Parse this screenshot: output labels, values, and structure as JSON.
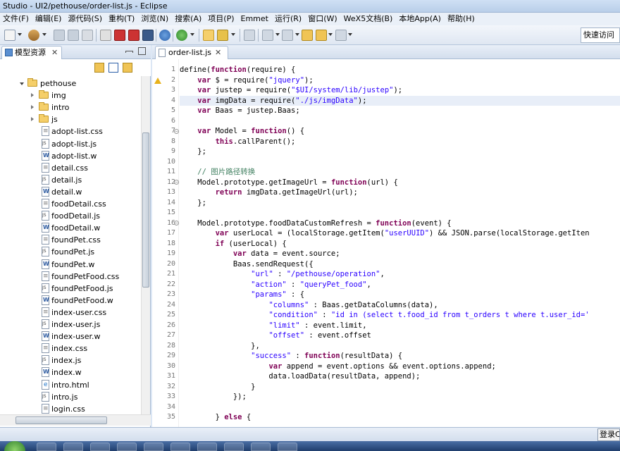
{
  "window": {
    "title": "Studio - UI2/pethouse/order-list.js - Eclipse"
  },
  "menu": [
    "文件(F)",
    "编辑(E)",
    "源代码(S)",
    "重构(T)",
    "浏览(N)",
    "搜索(A)",
    "项目(P)",
    "Emmet",
    "运行(R)",
    "窗口(W)",
    "WeX5文档(B)",
    "本地App(A)",
    "帮助(H)"
  ],
  "toolbar": {
    "quick_access": "快速访问"
  },
  "left_panel": {
    "tab_label": "模型资源",
    "close_glyph": "✕"
  },
  "tree": [
    {
      "label": "pethouse",
      "type": "folder",
      "level": 0,
      "state": "open"
    },
    {
      "label": "img",
      "type": "folder",
      "level": 1,
      "state": "closed"
    },
    {
      "label": "intro",
      "type": "folder",
      "level": 1,
      "state": "closed"
    },
    {
      "label": "js",
      "type": "folder",
      "level": 1,
      "state": "closed"
    },
    {
      "label": "adopt-list.css",
      "type": "css",
      "level": 1
    },
    {
      "label": "adopt-list.js",
      "type": "js",
      "level": 1
    },
    {
      "label": "adopt-list.w",
      "type": "w",
      "level": 1
    },
    {
      "label": "detail.css",
      "type": "css",
      "level": 1
    },
    {
      "label": "detail.js",
      "type": "js",
      "level": 1
    },
    {
      "label": "detail.w",
      "type": "w",
      "level": 1
    },
    {
      "label": "foodDetail.css",
      "type": "css",
      "level": 1
    },
    {
      "label": "foodDetail.js",
      "type": "js",
      "level": 1
    },
    {
      "label": "foodDetail.w",
      "type": "w",
      "level": 1
    },
    {
      "label": "foundPet.css",
      "type": "css",
      "level": 1
    },
    {
      "label": "foundPet.js",
      "type": "js",
      "level": 1
    },
    {
      "label": "foundPet.w",
      "type": "w",
      "level": 1
    },
    {
      "label": "foundPetFood.css",
      "type": "css",
      "level": 1
    },
    {
      "label": "foundPetFood.js",
      "type": "js",
      "level": 1
    },
    {
      "label": "foundPetFood.w",
      "type": "w",
      "level": 1
    },
    {
      "label": "index-user.css",
      "type": "css",
      "level": 1
    },
    {
      "label": "index-user.js",
      "type": "js",
      "level": 1
    },
    {
      "label": "index-user.w",
      "type": "w",
      "level": 1
    },
    {
      "label": "index.css",
      "type": "css",
      "level": 1
    },
    {
      "label": "index.js",
      "type": "js",
      "level": 1
    },
    {
      "label": "index.w",
      "type": "w",
      "level": 1
    },
    {
      "label": "intro.html",
      "type": "html",
      "level": 1
    },
    {
      "label": "intro.js",
      "type": "js",
      "level": 1
    },
    {
      "label": "login.css",
      "type": "css",
      "level": 1
    }
  ],
  "editor": {
    "tab_label": "order-list.js",
    "close_glyph": "✕",
    "warning_line": 2,
    "highlighted_line": 4,
    "fold_lines": [
      7,
      12,
      16
    ],
    "lines": [
      [
        [
          "define(",
          ""
        ],
        [
          "function",
          "kw"
        ],
        [
          "(require) {",
          ""
        ]
      ],
      [
        [
          "    ",
          ""
        ],
        [
          "var",
          "kw"
        ],
        [
          " $ = require(",
          ""
        ],
        [
          "\"jquery\"",
          "str"
        ],
        [
          ");",
          ""
        ]
      ],
      [
        [
          "    ",
          ""
        ],
        [
          "var",
          "kw"
        ],
        [
          " justep = require(",
          ""
        ],
        [
          "\"$UI/system/lib/justep\"",
          "str"
        ],
        [
          ");",
          ""
        ]
      ],
      [
        [
          "    ",
          ""
        ],
        [
          "var",
          "kw"
        ],
        [
          " imgData = require(",
          ""
        ],
        [
          "\"./js/imgData\"",
          "str"
        ],
        [
          ");",
          ""
        ]
      ],
      [
        [
          "    ",
          ""
        ],
        [
          "var",
          "kw"
        ],
        [
          " Baas = justep.Baas;",
          ""
        ]
      ],
      [
        [
          "",
          ""
        ]
      ],
      [
        [
          "    ",
          ""
        ],
        [
          "var",
          "kw"
        ],
        [
          " Model = ",
          ""
        ],
        [
          "function",
          "kw"
        ],
        [
          "() {",
          ""
        ]
      ],
      [
        [
          "        ",
          ""
        ],
        [
          "this",
          "kw"
        ],
        [
          ".callParent();",
          ""
        ]
      ],
      [
        [
          "    };",
          ""
        ]
      ],
      [
        [
          "",
          ""
        ]
      ],
      [
        [
          "    ",
          ""
        ],
        [
          "// 图片路径转换",
          "cm"
        ]
      ],
      [
        [
          "    Model.prototype.getImageUrl = ",
          ""
        ],
        [
          "function",
          "kw"
        ],
        [
          "(url) {",
          ""
        ]
      ],
      [
        [
          "        ",
          ""
        ],
        [
          "return",
          "kw"
        ],
        [
          " imgData.getImageUrl(url);",
          ""
        ]
      ],
      [
        [
          "    };",
          ""
        ]
      ],
      [
        [
          "",
          ""
        ]
      ],
      [
        [
          "    Model.prototype.foodDataCustomRefresh = ",
          ""
        ],
        [
          "function",
          "kw"
        ],
        [
          "(event) {",
          ""
        ]
      ],
      [
        [
          "        ",
          ""
        ],
        [
          "var",
          "kw"
        ],
        [
          " userLocal = (localStorage.getItem(",
          ""
        ],
        [
          "\"userUUID\"",
          "str"
        ],
        [
          ") && JSON.parse(localStorage.getIten",
          ""
        ]
      ],
      [
        [
          "        ",
          ""
        ],
        [
          "if",
          "kw"
        ],
        [
          " (userLocal) {",
          ""
        ]
      ],
      [
        [
          "            ",
          ""
        ],
        [
          "var",
          "kw"
        ],
        [
          " data = event.source;",
          ""
        ]
      ],
      [
        [
          "            Baas.sendRequest({",
          ""
        ]
      ],
      [
        [
          "                ",
          ""
        ],
        [
          "\"url\"",
          "str"
        ],
        [
          " : ",
          ""
        ],
        [
          "\"/pethouse/operation\"",
          "str"
        ],
        [
          ",",
          ""
        ]
      ],
      [
        [
          "                ",
          ""
        ],
        [
          "\"action\"",
          "str"
        ],
        [
          " : ",
          ""
        ],
        [
          "\"queryPet_food\"",
          "str"
        ],
        [
          ",",
          ""
        ]
      ],
      [
        [
          "                ",
          ""
        ],
        [
          "\"params\"",
          "str"
        ],
        [
          " : {",
          ""
        ]
      ],
      [
        [
          "                    ",
          ""
        ],
        [
          "\"columns\"",
          "str"
        ],
        [
          " : Baas.getDataColumns(data),",
          ""
        ]
      ],
      [
        [
          "                    ",
          ""
        ],
        [
          "\"condition\"",
          "str"
        ],
        [
          " : ",
          ""
        ],
        [
          "\"id in (select t.food_id from t_orders t where t.user_id='",
          "str"
        ]
      ],
      [
        [
          "                    ",
          ""
        ],
        [
          "\"limit\"",
          "str"
        ],
        [
          " : event.limit,",
          ""
        ]
      ],
      [
        [
          "                    ",
          ""
        ],
        [
          "\"offset\"",
          "str"
        ],
        [
          " : event.offset",
          ""
        ]
      ],
      [
        [
          "                },",
          ""
        ]
      ],
      [
        [
          "                ",
          ""
        ],
        [
          "\"success\"",
          "str"
        ],
        [
          " : ",
          ""
        ],
        [
          "function",
          "kw"
        ],
        [
          "(resultData) {",
          ""
        ]
      ],
      [
        [
          "                    ",
          ""
        ],
        [
          "var",
          "kw"
        ],
        [
          " append = event.options && event.options.append;",
          ""
        ]
      ],
      [
        [
          "                    data.loadData(resultData, append);",
          ""
        ]
      ],
      [
        [
          "                }",
          ""
        ]
      ],
      [
        [
          "            });",
          ""
        ]
      ],
      [
        [
          "",
          ""
        ]
      ],
      [
        [
          "        } ",
          ""
        ],
        [
          "else",
          "kw"
        ],
        [
          " {",
          ""
        ]
      ]
    ]
  },
  "statusbar": {
    "login_label": "登录C"
  },
  "colors": {
    "keyword": "#7f0055",
    "string": "#2a00ff",
    "comment": "#3f7f5f",
    "highlight": "#e8eef8"
  }
}
